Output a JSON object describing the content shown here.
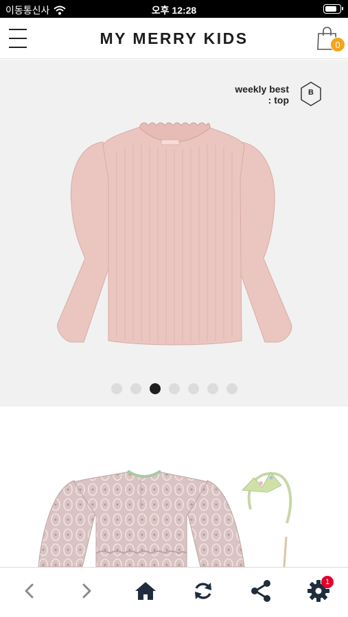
{
  "status_bar": {
    "carrier": "이동통신사",
    "time": "오후 12:28",
    "battery_level": 0.85,
    "wifi_icon": "wifi-icon"
  },
  "header": {
    "title": "MY MERRY KIDS",
    "menu_icon": "hamburger-menu-icon",
    "cart_icon": "shopping-bag-icon",
    "cart_count": "0"
  },
  "hero": {
    "badge_line1": "weekly best",
    "badge_line2": ": top",
    "grade_label": "B",
    "slide_count": 7,
    "active_slide": 3,
    "background": "#f1f1f1",
    "product_color": "#ebc6c1"
  },
  "bottom_nav": {
    "items": [
      {
        "icon": "chevron-left-icon"
      },
      {
        "icon": "chevron-right-icon"
      },
      {
        "icon": "home-icon"
      },
      {
        "icon": "refresh-icon"
      },
      {
        "icon": "share-icon"
      },
      {
        "icon": "gear-icon",
        "badge": "1"
      }
    ]
  }
}
